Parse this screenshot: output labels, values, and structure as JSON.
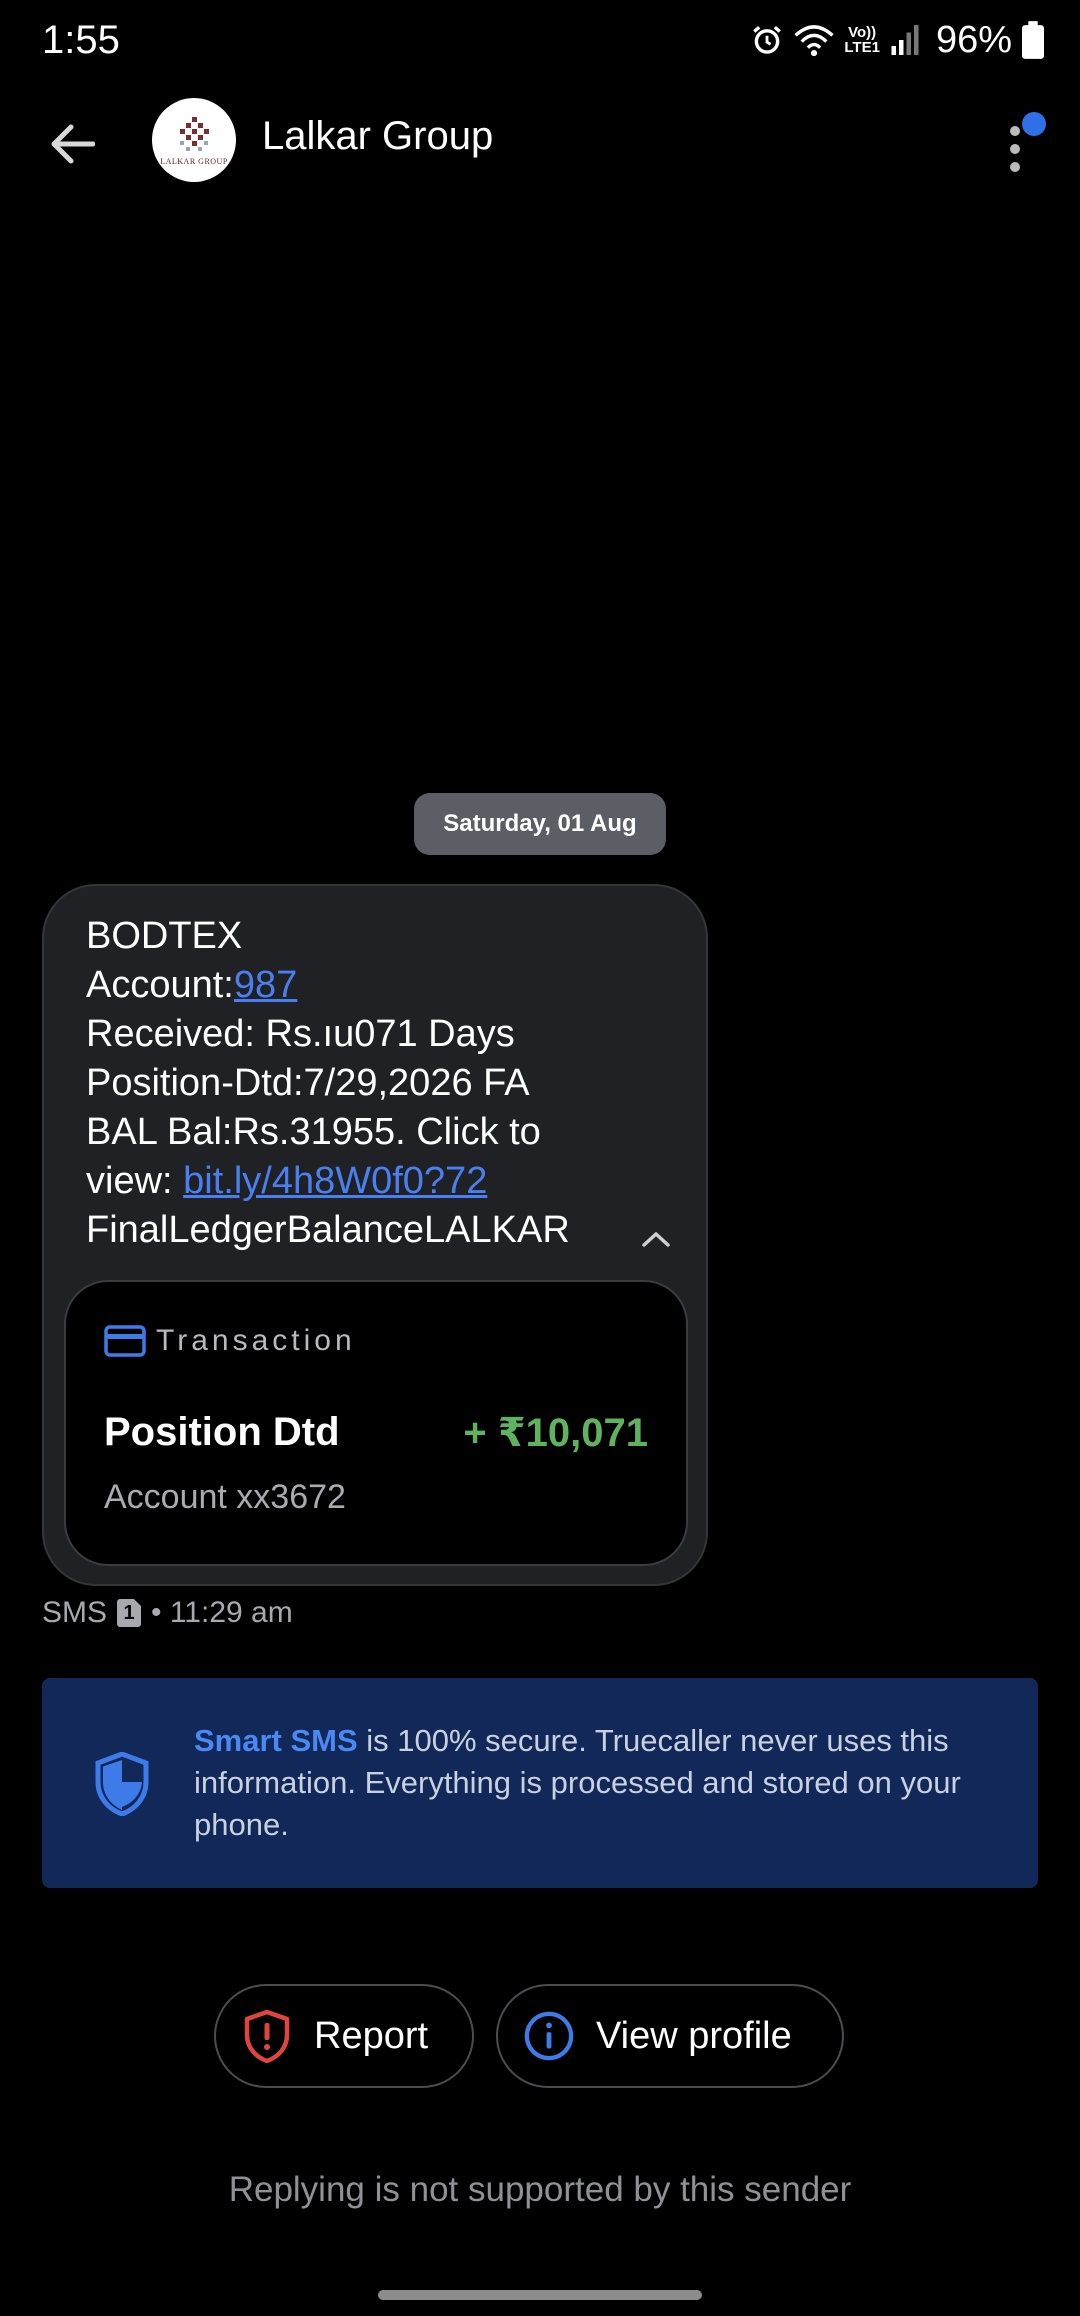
{
  "status_bar": {
    "time": "1:55",
    "battery": "96%",
    "network_label": "Vo))\nLTE1"
  },
  "header": {
    "title": "Lalkar Group",
    "avatar_text": "LALKAR GROUP"
  },
  "date_chip": "Saturday, 01 Aug",
  "message": {
    "line1": "BODTEX",
    "line2_prefix": "Account:",
    "line2_link": "987",
    "line3": "Received: Rs.ıu071 Days",
    "line4": "Position-Dtd:7/29,2026 FA",
    "line5": "BAL Bal:Rs.31955. Click to",
    "line6_prefix": "view: ",
    "line6_link": "bit.ly/4h8W0f0?72",
    "line7": "FinalLedgerBalanceLALKAR"
  },
  "transaction": {
    "label": "Transaction",
    "name": "Position Dtd",
    "amount": "+ ₹10,071",
    "account": "Account xx3672"
  },
  "meta": {
    "type": "SMS",
    "sim": "1",
    "time": "• 11:29 am"
  },
  "info_banner": {
    "highlight": "Smart SMS",
    "text": " is 100% secure. Truecaller never uses this information. Everything is processed and stored on your phone."
  },
  "actions": {
    "report": "Report",
    "view_profile": "View profile"
  },
  "footer_note": "Replying is not supported by this sender",
  "colors": {
    "accent_blue": "#2f6fe8",
    "link_blue": "#4a7ff0",
    "amount_green": "#5fb35f",
    "report_red": "#e0453a",
    "banner_bg": "#112858"
  }
}
